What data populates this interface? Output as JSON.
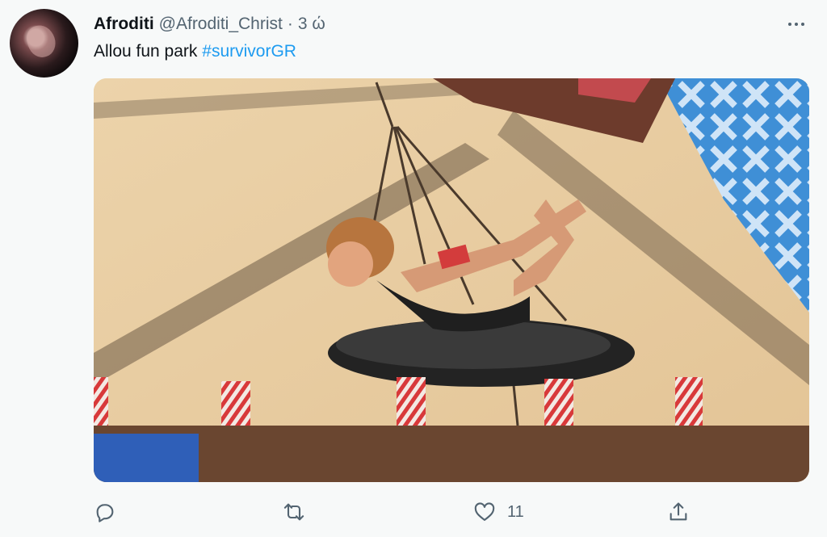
{
  "tweet": {
    "display_name": "Afroditi",
    "handle": "@Afroditi_Christ",
    "separator": "·",
    "time": "3 ώ",
    "text_plain": "Allou fun park",
    "hashtag": "#survivorGR",
    "media_alt": "Contestant lying on a hanging swing platform over a sandy course"
  },
  "actions": {
    "reply_count": "",
    "retweet_count": "",
    "like_count": "11"
  },
  "icons": {
    "avatar": "user-avatar",
    "more": "more-dots-icon",
    "reply": "reply-icon",
    "retweet": "retweet-icon",
    "like": "heart-icon",
    "share": "share-icon"
  },
  "colors": {
    "background": "#f7f9f9",
    "text_primary": "#0f1419",
    "text_secondary": "#536471",
    "link": "#1d9bf0"
  }
}
